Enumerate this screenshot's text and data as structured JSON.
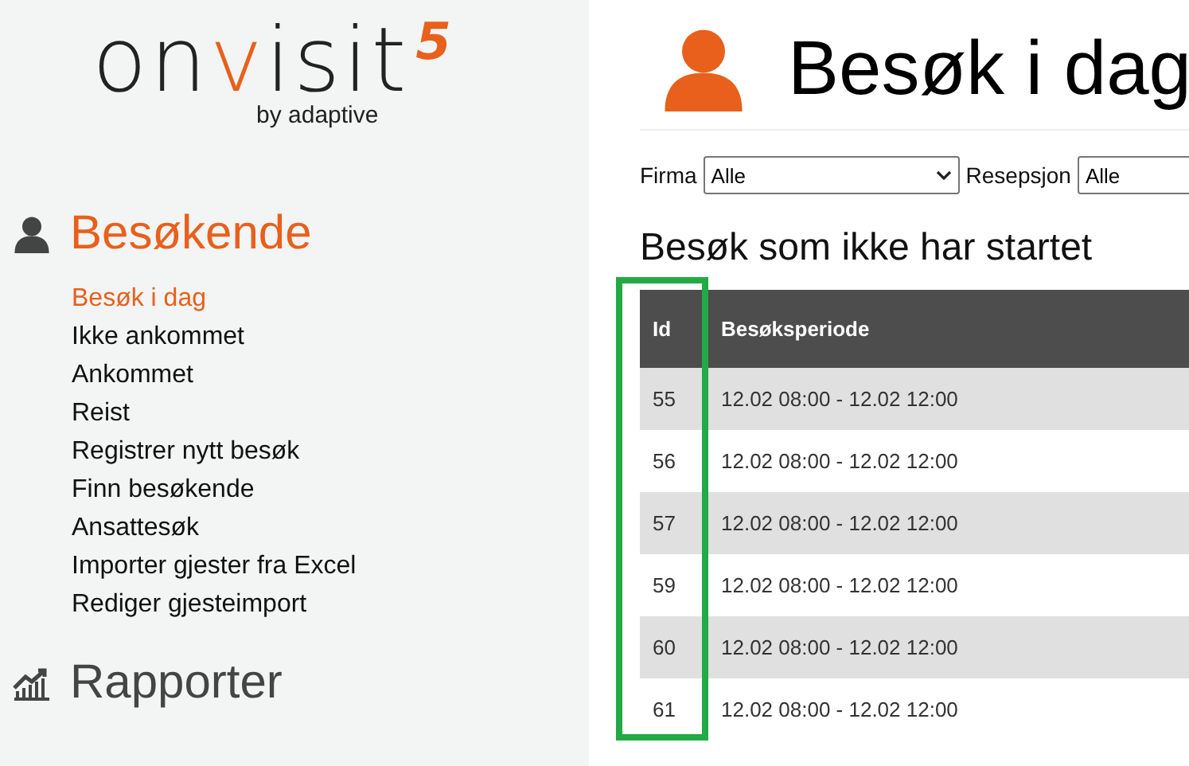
{
  "logo": {
    "start": "on",
    "accent": "v",
    "end": "isit",
    "version": "5",
    "tagline": "by adaptive"
  },
  "sidebar": {
    "sections": [
      {
        "kind": "visitors",
        "title": "Besøkende",
        "selected": true,
        "items": [
          {
            "label": "Besøk i dag",
            "selected": true
          },
          {
            "label": "Ikke ankommet",
            "selected": false
          },
          {
            "label": "Ankommet",
            "selected": false
          },
          {
            "label": "Reist",
            "selected": false
          },
          {
            "label": "Registrer nytt besøk",
            "selected": false
          },
          {
            "label": "Finn besøkende",
            "selected": false
          },
          {
            "label": "Ansattesøk",
            "selected": false
          },
          {
            "label": "Importer gjester fra Excel",
            "selected": false
          },
          {
            "label": "Rediger gjesteimport",
            "selected": false
          }
        ]
      },
      {
        "kind": "reports",
        "title": "Rapporter",
        "selected": false
      }
    ]
  },
  "page": {
    "title": "Besøk i dag"
  },
  "filters": [
    {
      "label": "Firma",
      "value": "Alle"
    },
    {
      "label": "Resepsjon",
      "value": "Alle"
    }
  ],
  "table": {
    "title": "Besøk som ikke har startet",
    "id_column_framed": true,
    "columns": [
      "Id",
      "Besøksperiode"
    ],
    "rows": [
      [
        "55",
        "12.02 08:00 - 12.02 12:00"
      ],
      [
        "56",
        "12.02 08:00 - 12.02 12:00"
      ],
      [
        "57",
        "12.02 08:00 - 12.02 12:00"
      ],
      [
        "59",
        "12.02 08:00 - 12.02 12:00"
      ],
      [
        "60",
        "12.02 08:00 - 12.02 12:00"
      ],
      [
        "61",
        "12.02 08:00 - 12.02 12:00"
      ]
    ]
  }
}
